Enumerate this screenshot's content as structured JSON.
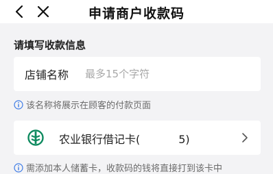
{
  "nav": {
    "title": "申请商户收款码",
    "back_icon": "back-arrow-icon",
    "close_icon": "close-icon"
  },
  "section": {
    "heading": "请填写收款信息"
  },
  "store_name": {
    "label": "店铺名称",
    "value": "",
    "placeholder": "最多15个字符"
  },
  "hint1": "该名称将展示在顾客的付款页面",
  "bank": {
    "logo_icon": "abc-bank-logo-icon",
    "label_prefix": "农业银行借记卡(",
    "label_suffix": "5)",
    "chevron_icon": "chevron-right-icon"
  },
  "hint2": "需添加本人储蓄卡，收款码的钱将直接打到该卡中",
  "colors": {
    "background": "#f3f3f5",
    "card": "#ffffff",
    "info_blue": "#3d7be6",
    "bank_green": "#0e8a5f",
    "placeholder": "#a8a8a8"
  }
}
